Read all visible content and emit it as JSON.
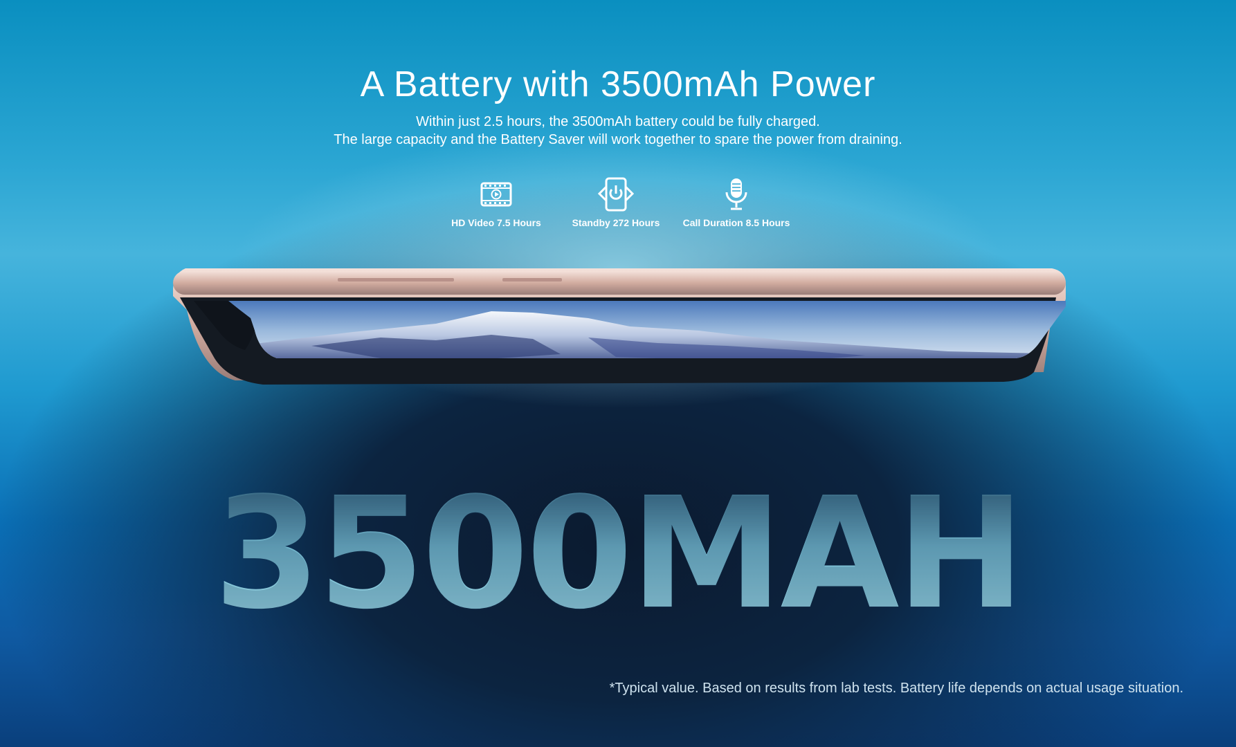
{
  "hero": {
    "title": "A Battery with 3500mAh Power",
    "subtitle_line1": "Within just 2.5 hours, the 3500mAh battery could be fully charged.",
    "subtitle_line2": "The large capacity and the Battery Saver will work together to spare the power from draining."
  },
  "features": [
    {
      "icon": "video-icon",
      "label": "HD Video 7.5 Hours"
    },
    {
      "icon": "phone-power-icon",
      "label": "Standby 272 Hours"
    },
    {
      "icon": "microphone-icon",
      "label": "Call Duration 8.5 Hours"
    }
  ],
  "big_number": "3500MAH",
  "footnote": "*Typical value. Based on results from lab tests. Battery life depends on actual usage situation.",
  "colors": {
    "background_top": "#0a8fc0",
    "background_bottom": "#0a3f7c",
    "frame_rose_gold": "#d8b3a8",
    "big_number": "#8fd0e0"
  }
}
